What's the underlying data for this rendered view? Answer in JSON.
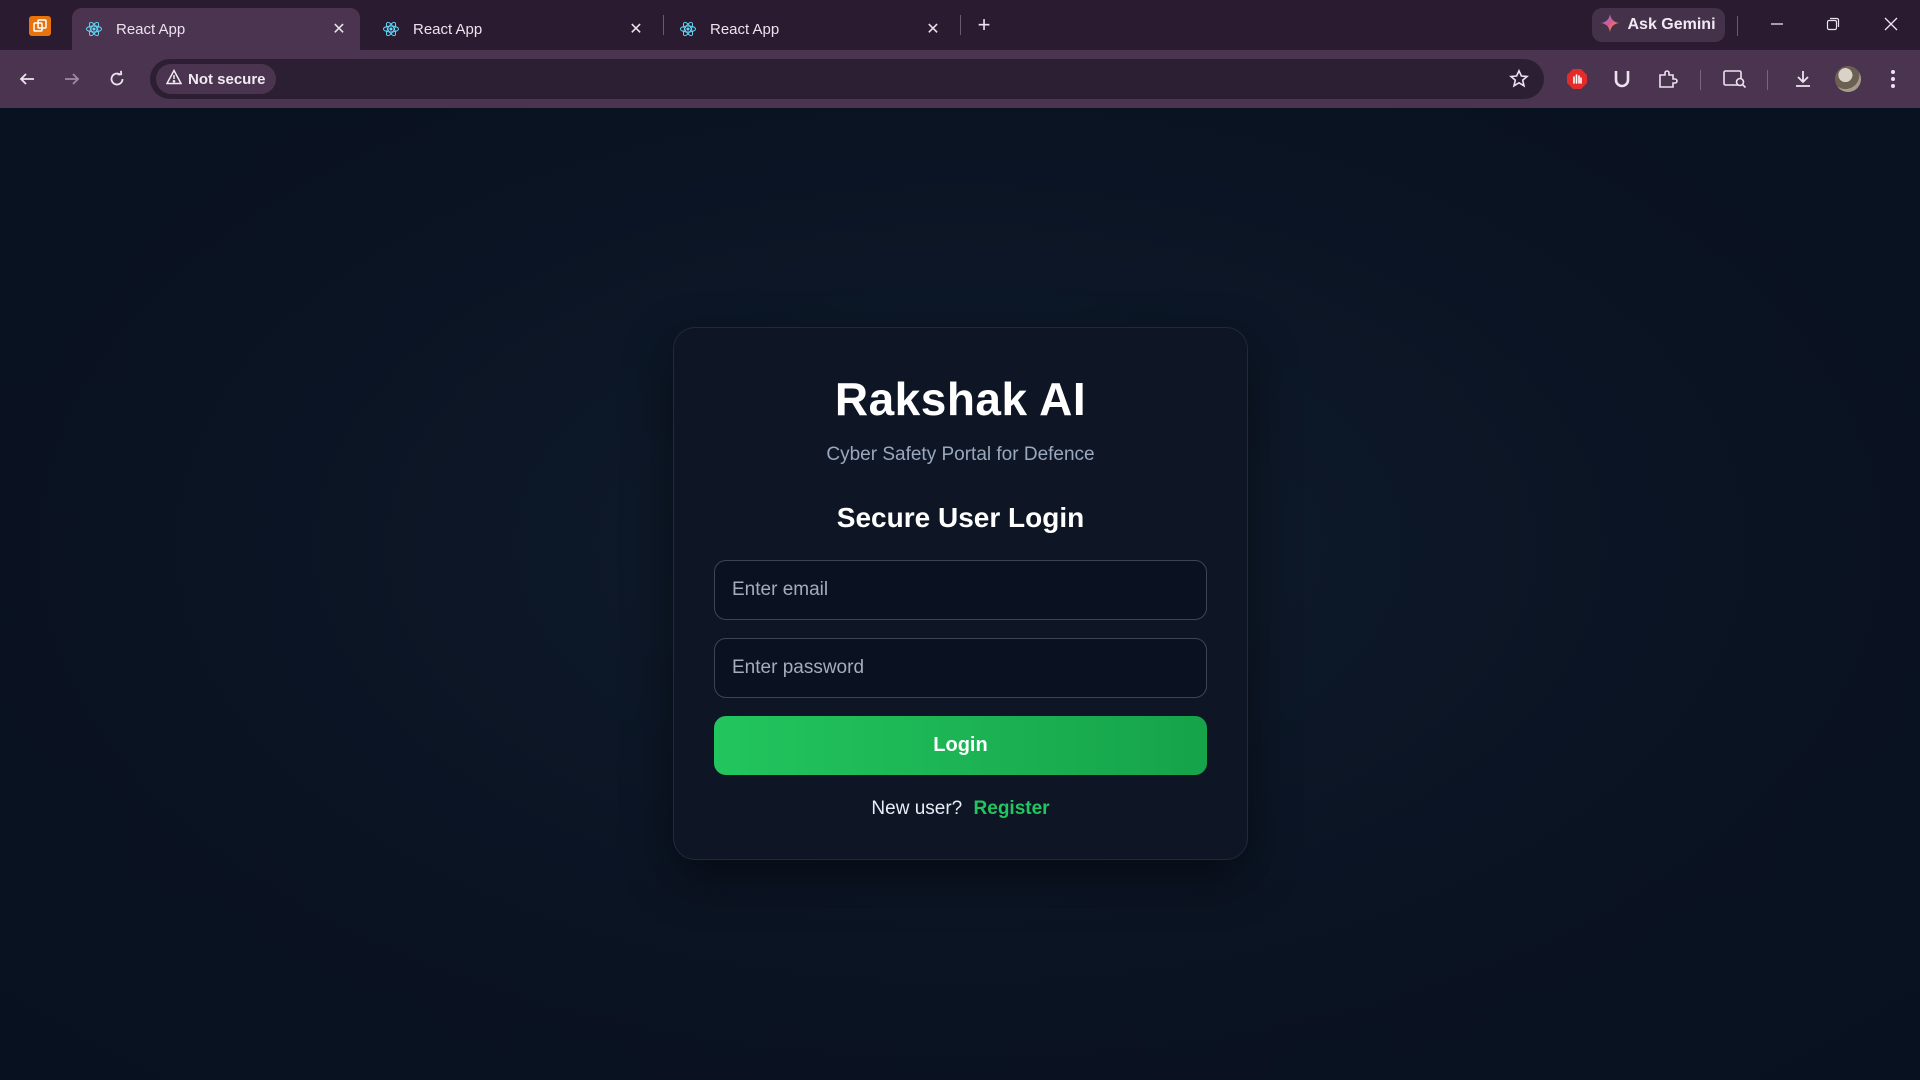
{
  "browser": {
    "tabs": [
      {
        "title": "React App",
        "active": true
      },
      {
        "title": "React App",
        "active": false
      },
      {
        "title": "React App",
        "active": false
      }
    ],
    "gemini_label": "Ask Gemini",
    "security_chip": "Not secure",
    "url": ""
  },
  "app": {
    "brand": "Rakshak AI",
    "tagline": "Cyber Safety Portal for Defence",
    "heading": "Secure User Login",
    "email_placeholder": "Enter email",
    "password_placeholder": "Enter password",
    "login_label": "Login",
    "new_user_text": "New user?",
    "register_label": "Register"
  },
  "colors": {
    "accent_green": "#22c55e",
    "page_bg": "#0b1322",
    "card_bg": "#0e1626",
    "tabstrip_bg": "#2b1b30",
    "toolbar_bg": "#4a3450"
  },
  "icons": {
    "tab_favicon": "react-icon",
    "security": "warning-triangle-icon"
  }
}
